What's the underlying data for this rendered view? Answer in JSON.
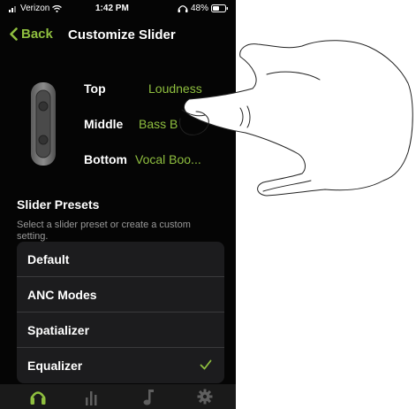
{
  "status_bar": {
    "carrier": "Verizon",
    "time": "1:42 PM",
    "battery": "48%"
  },
  "nav": {
    "back_label": "Back",
    "title": "Customize Slider"
  },
  "slider_rows": [
    {
      "label": "Top",
      "value": "Loudness"
    },
    {
      "label": "Middle",
      "value": "Bass B"
    },
    {
      "label": "Bottom",
      "value": "Vocal Boo..."
    }
  ],
  "presets_section": {
    "title": "Slider Presets",
    "description": "Select a slider preset or create a custom setting.",
    "items": [
      {
        "label": "Default",
        "selected": false
      },
      {
        "label": "ANC Modes",
        "selected": false
      },
      {
        "label": "Spatializer",
        "selected": false
      },
      {
        "label": "Equalizer",
        "selected": true
      }
    ]
  },
  "tab_bar": [
    "headphones-icon",
    "equalizer-bars-icon",
    "music-note-icon",
    "gear-icon"
  ],
  "colors": {
    "accent": "#8fbf3f",
    "background": "#050505",
    "card": "#1c1c1e"
  }
}
